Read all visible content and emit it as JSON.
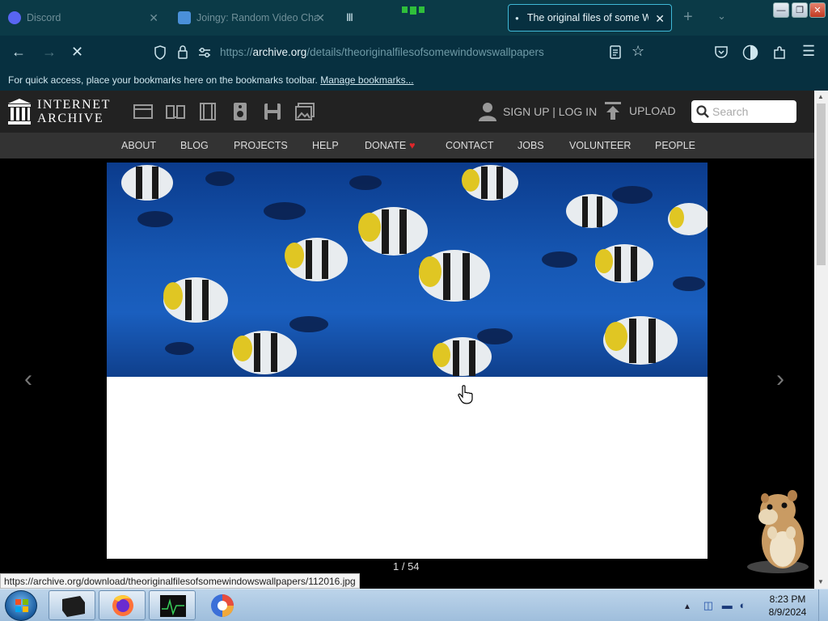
{
  "browser": {
    "tabs": [
      {
        "label": "Discord",
        "active": false
      },
      {
        "label": "Joingy: Random Video Chat",
        "active": false
      },
      {
        "label": "",
        "active": false
      },
      {
        "label": "The original files of some W",
        "active": true
      }
    ],
    "new_tab": "+",
    "tab_list": "⌄",
    "window_controls": {
      "minimize": "—",
      "maximize": "❐",
      "close": "✕"
    },
    "url_prefix": "https://",
    "url_host": "archive.org",
    "url_path": "/details/theoriginalfilesofsomewindowswallpapers",
    "bookmarks_text": "For quick access, place your bookmarks here on the bookmarks toolbar.",
    "bookmarks_link": "Manage bookmarks...",
    "status_url": "https://archive.org/download/theoriginalfilesofsomewindowswallpapers/112016.jpg"
  },
  "archive": {
    "logo_line1": "INTERNET",
    "logo_line2": "ARCHIVE",
    "signup_login": "SIGN UP | LOG IN",
    "upload": "UPLOAD",
    "search_placeholder": "Search",
    "nav": [
      "ABOUT",
      "BLOG",
      "PROJECTS",
      "HELP",
      "DONATE",
      "CONTACT",
      "JOBS",
      "VOLUNTEER",
      "PEOPLE"
    ],
    "counter": "1 / 54"
  },
  "taskbar": {
    "clock_time": "8:23 PM",
    "clock_date": "8/9/2024"
  },
  "colors": {
    "tab_bg": "#0b3a47",
    "active_tab_border": "#3fb8d6",
    "ia_header": "#222222",
    "ia_nav": "#333333",
    "donate_heart": "#e0262a"
  }
}
